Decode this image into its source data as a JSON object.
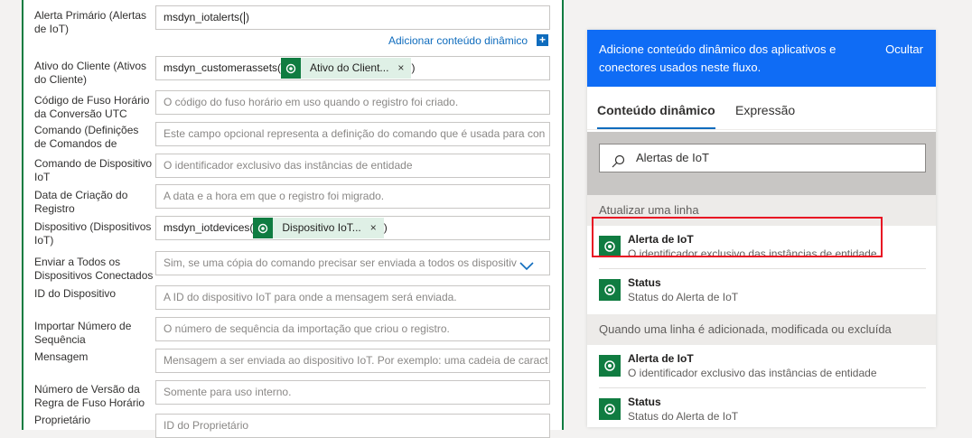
{
  "form": {
    "dynamic_link": "Adicionar conteúdo dinâmico",
    "fields": [
      {
        "label": "Alerta Primário (Alertas de IoT)",
        "value": "msdyn_iotalerts()",
        "placeholder": ""
      },
      {
        "label": "Ativo do Cliente (Ativos do Cliente)",
        "value_prefix": "msdyn_customerassets(",
        "token": "Ativo do Client...",
        "value_suffix": ")"
      },
      {
        "label": "Código de Fuso Horário da Conversão UTC",
        "placeholder": "O código do fuso horário em uso quando o registro foi criado."
      },
      {
        "label": "Comando (Definições de Comandos de Dispositivo IoT)",
        "placeholder": "Este campo opcional representa a definição do comando que é usada para con"
      },
      {
        "label": "Comando de Dispositivo IoT",
        "placeholder": "O identificador exclusivo das instâncias de entidade"
      },
      {
        "label": "Data de Criação do Registro",
        "placeholder": "A data e a hora em que o registro foi migrado."
      },
      {
        "label": "Dispositivo (Dispositivos IoT)",
        "value_prefix": "msdyn_iotdevices(",
        "token": "Dispositivo IoT...",
        "value_suffix": ")"
      },
      {
        "label": "Enviar a Todos os Dispositivos Conectados",
        "placeholder": "Sim, se uma cópia do comando precisar ser enviada a todos os dispositiv"
      },
      {
        "label": "ID do Dispositivo",
        "placeholder": "A ID do dispositivo IoT para onde a mensagem será enviada."
      },
      {
        "label": "Importar Número de Sequência",
        "placeholder": "O número de sequência da importação que criou o registro."
      },
      {
        "label": "Mensagem",
        "placeholder": "Mensagem a ser enviada ao dispositivo IoT. Por exemplo: uma cadeia de caract"
      },
      {
        "label": "Número de Versão da Regra de Fuso Horário",
        "placeholder": "Somente para uso interno."
      },
      {
        "label": "Proprietário",
        "placeholder": "ID do Proprietário"
      }
    ],
    "token_close": "×"
  },
  "panel": {
    "header_message": "Adicione conteúdo dinâmico dos aplicativos e conectores usados neste fluxo.",
    "hide_label": "Ocultar",
    "tabs": [
      "Conteúdo dinâmico",
      "Expressão"
    ],
    "search_value": "Alertas de IoT",
    "sections": [
      {
        "title": "Atualizar uma linha",
        "items": [
          {
            "title": "Alerta de IoT",
            "desc": "O identificador exclusivo das instâncias de entidade"
          },
          {
            "title": "Status",
            "desc": "Status do Alerta de IoT"
          }
        ]
      },
      {
        "title": "Quando uma linha é adicionada, modificada ou excluída",
        "items": [
          {
            "title": "Alerta de IoT",
            "desc": "O identificador exclusivo das instâncias de entidade"
          },
          {
            "title": "Status",
            "desc": "Status do Alerta de IoT"
          }
        ]
      }
    ]
  },
  "colors": {
    "accent": "#0f6cbd",
    "header": "#0f6cf5",
    "dataverse": "#107c41",
    "highlight": "#e81123"
  }
}
